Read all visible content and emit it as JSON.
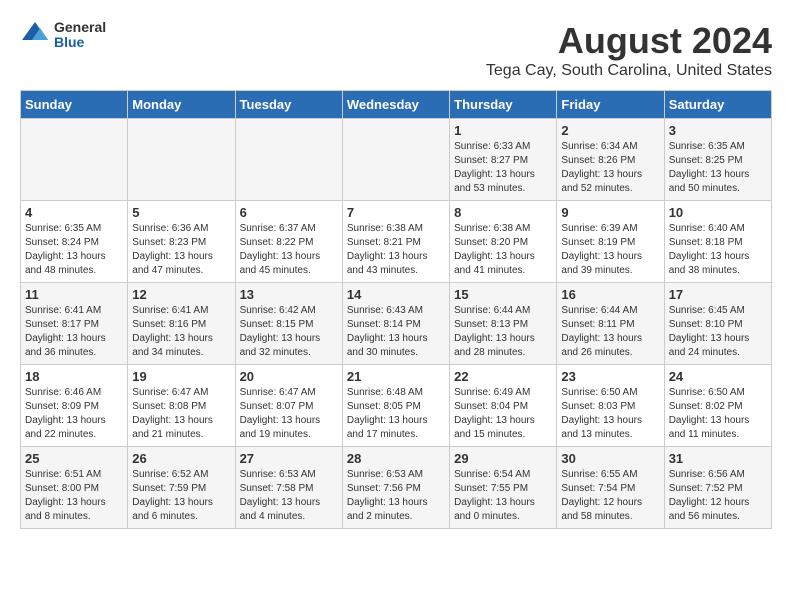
{
  "header": {
    "logo_general": "General",
    "logo_blue": "Blue",
    "month_year": "August 2024",
    "location": "Tega Cay, South Carolina, United States"
  },
  "weekdays": [
    "Sunday",
    "Monday",
    "Tuesday",
    "Wednesday",
    "Thursday",
    "Friday",
    "Saturday"
  ],
  "weeks": [
    [
      {
        "day": "",
        "info": ""
      },
      {
        "day": "",
        "info": ""
      },
      {
        "day": "",
        "info": ""
      },
      {
        "day": "",
        "info": ""
      },
      {
        "day": "1",
        "info": "Sunrise: 6:33 AM\nSunset: 8:27 PM\nDaylight: 13 hours\nand 53 minutes."
      },
      {
        "day": "2",
        "info": "Sunrise: 6:34 AM\nSunset: 8:26 PM\nDaylight: 13 hours\nand 52 minutes."
      },
      {
        "day": "3",
        "info": "Sunrise: 6:35 AM\nSunset: 8:25 PM\nDaylight: 13 hours\nand 50 minutes."
      }
    ],
    [
      {
        "day": "4",
        "info": "Sunrise: 6:35 AM\nSunset: 8:24 PM\nDaylight: 13 hours\nand 48 minutes."
      },
      {
        "day": "5",
        "info": "Sunrise: 6:36 AM\nSunset: 8:23 PM\nDaylight: 13 hours\nand 47 minutes."
      },
      {
        "day": "6",
        "info": "Sunrise: 6:37 AM\nSunset: 8:22 PM\nDaylight: 13 hours\nand 45 minutes."
      },
      {
        "day": "7",
        "info": "Sunrise: 6:38 AM\nSunset: 8:21 PM\nDaylight: 13 hours\nand 43 minutes."
      },
      {
        "day": "8",
        "info": "Sunrise: 6:38 AM\nSunset: 8:20 PM\nDaylight: 13 hours\nand 41 minutes."
      },
      {
        "day": "9",
        "info": "Sunrise: 6:39 AM\nSunset: 8:19 PM\nDaylight: 13 hours\nand 39 minutes."
      },
      {
        "day": "10",
        "info": "Sunrise: 6:40 AM\nSunset: 8:18 PM\nDaylight: 13 hours\nand 38 minutes."
      }
    ],
    [
      {
        "day": "11",
        "info": "Sunrise: 6:41 AM\nSunset: 8:17 PM\nDaylight: 13 hours\nand 36 minutes."
      },
      {
        "day": "12",
        "info": "Sunrise: 6:41 AM\nSunset: 8:16 PM\nDaylight: 13 hours\nand 34 minutes."
      },
      {
        "day": "13",
        "info": "Sunrise: 6:42 AM\nSunset: 8:15 PM\nDaylight: 13 hours\nand 32 minutes."
      },
      {
        "day": "14",
        "info": "Sunrise: 6:43 AM\nSunset: 8:14 PM\nDaylight: 13 hours\nand 30 minutes."
      },
      {
        "day": "15",
        "info": "Sunrise: 6:44 AM\nSunset: 8:13 PM\nDaylight: 13 hours\nand 28 minutes."
      },
      {
        "day": "16",
        "info": "Sunrise: 6:44 AM\nSunset: 8:11 PM\nDaylight: 13 hours\nand 26 minutes."
      },
      {
        "day": "17",
        "info": "Sunrise: 6:45 AM\nSunset: 8:10 PM\nDaylight: 13 hours\nand 24 minutes."
      }
    ],
    [
      {
        "day": "18",
        "info": "Sunrise: 6:46 AM\nSunset: 8:09 PM\nDaylight: 13 hours\nand 22 minutes."
      },
      {
        "day": "19",
        "info": "Sunrise: 6:47 AM\nSunset: 8:08 PM\nDaylight: 13 hours\nand 21 minutes."
      },
      {
        "day": "20",
        "info": "Sunrise: 6:47 AM\nSunset: 8:07 PM\nDaylight: 13 hours\nand 19 minutes."
      },
      {
        "day": "21",
        "info": "Sunrise: 6:48 AM\nSunset: 8:05 PM\nDaylight: 13 hours\nand 17 minutes."
      },
      {
        "day": "22",
        "info": "Sunrise: 6:49 AM\nSunset: 8:04 PM\nDaylight: 13 hours\nand 15 minutes."
      },
      {
        "day": "23",
        "info": "Sunrise: 6:50 AM\nSunset: 8:03 PM\nDaylight: 13 hours\nand 13 minutes."
      },
      {
        "day": "24",
        "info": "Sunrise: 6:50 AM\nSunset: 8:02 PM\nDaylight: 13 hours\nand 11 minutes."
      }
    ],
    [
      {
        "day": "25",
        "info": "Sunrise: 6:51 AM\nSunset: 8:00 PM\nDaylight: 13 hours\nand 8 minutes."
      },
      {
        "day": "26",
        "info": "Sunrise: 6:52 AM\nSunset: 7:59 PM\nDaylight: 13 hours\nand 6 minutes."
      },
      {
        "day": "27",
        "info": "Sunrise: 6:53 AM\nSunset: 7:58 PM\nDaylight: 13 hours\nand 4 minutes."
      },
      {
        "day": "28",
        "info": "Sunrise: 6:53 AM\nSunset: 7:56 PM\nDaylight: 13 hours\nand 2 minutes."
      },
      {
        "day": "29",
        "info": "Sunrise: 6:54 AM\nSunset: 7:55 PM\nDaylight: 13 hours\nand 0 minutes."
      },
      {
        "day": "30",
        "info": "Sunrise: 6:55 AM\nSunset: 7:54 PM\nDaylight: 12 hours\nand 58 minutes."
      },
      {
        "day": "31",
        "info": "Sunrise: 6:56 AM\nSunset: 7:52 PM\nDaylight: 12 hours\nand 56 minutes."
      }
    ]
  ]
}
